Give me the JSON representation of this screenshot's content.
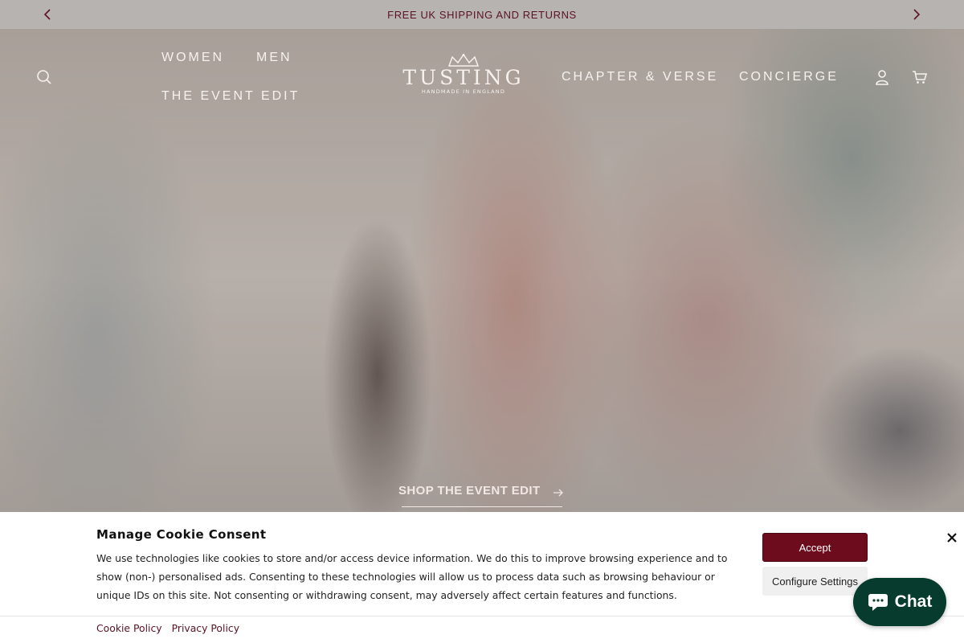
{
  "announcement": {
    "text": "FREE UK SHIPPING AND RETURNS",
    "prev_icon": "chevron-left-icon",
    "next_icon": "chevron-right-icon"
  },
  "nav": {
    "left": [
      {
        "label": "WOMEN"
      },
      {
        "label": "MEN"
      },
      {
        "label": "THE EVENT EDIT"
      }
    ],
    "right": [
      {
        "label": "CHAPTER & VERSE"
      },
      {
        "label": "CONCIERGE"
      }
    ],
    "icons": {
      "search": "search-icon",
      "account": "account-icon",
      "cart": "cart-icon"
    }
  },
  "logo": {
    "wordmark": "TUSTING",
    "tagline": "HANDMADE IN ENGLAND"
  },
  "hero": {
    "cta_label": "SHOP THE EVENT EDIT",
    "cta_icon": "arrow-right-icon"
  },
  "cookie": {
    "title": "Manage Cookie Consent",
    "body": "We use technologies like cookies to store and/or access device information. We do this to improve browsing experience and to show (non-) personalised ads. Consenting to these technologies will allow us to process data such as browsing behaviour or unique IDs on this site. Not consenting or withdrawing consent, may adversely affect certain features and functions.",
    "accept_label": "Accept",
    "configure_label": "Configure Settings",
    "links": [
      {
        "label": "Cookie Policy"
      },
      {
        "label": "Privacy Policy"
      }
    ]
  },
  "chat": {
    "label": "Chat",
    "icon": "chat-bubble-icon"
  },
  "colors": {
    "brand": "#6d0c1d",
    "announce_bg": "#b7b3b1",
    "chat_bg": "#073b2e",
    "nav_text": "#f6f1ee"
  }
}
